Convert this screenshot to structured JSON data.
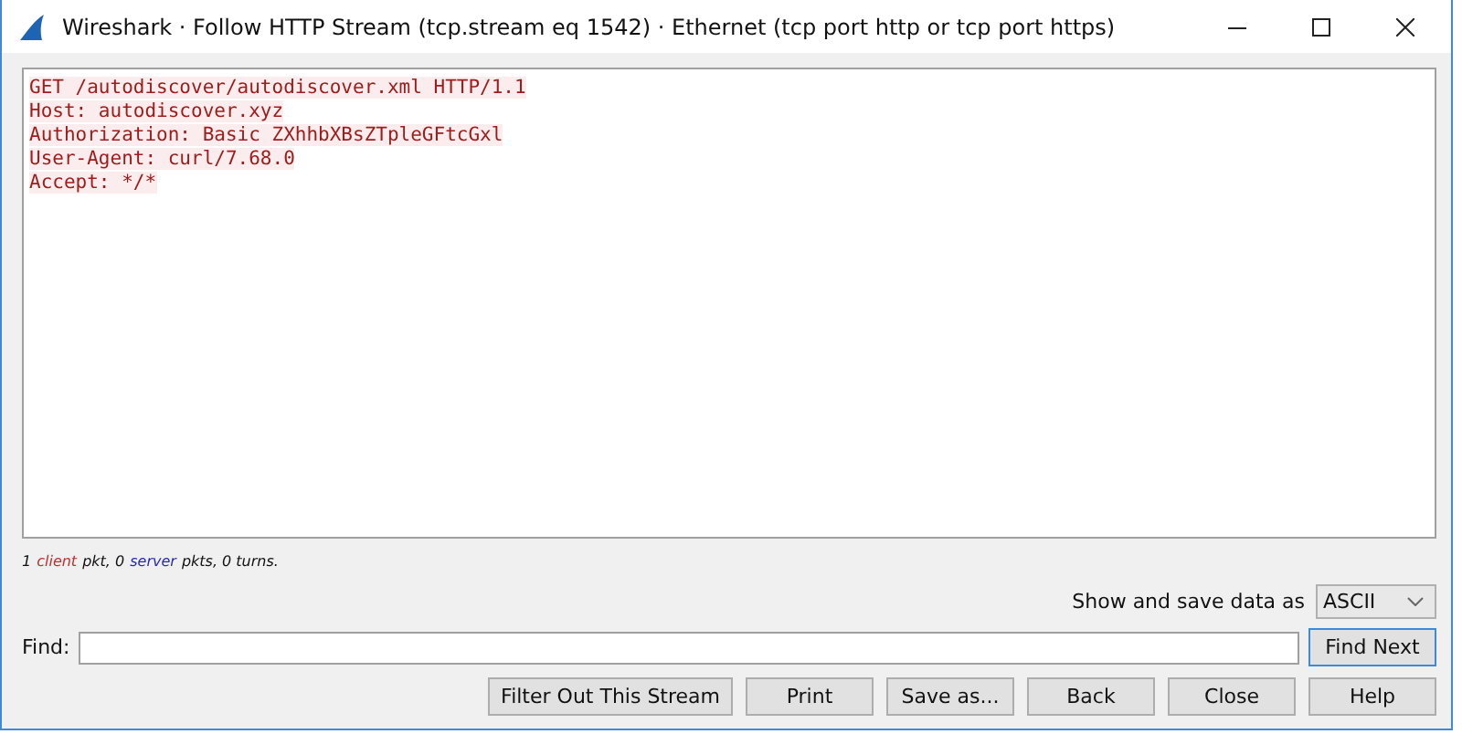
{
  "window": {
    "title": "Wireshark · Follow HTTP Stream (tcp.stream eq 1542) · Ethernet (tcp port http or tcp port https)"
  },
  "stream_lines": [
    {
      "kind": "client",
      "text": "GET /autodiscover/autodiscover.xml HTTP/1.1"
    },
    {
      "kind": "client",
      "text": "Host: autodiscover.xyz"
    },
    {
      "kind": "client",
      "text": "Authorization: Basic ZXhhbXBsZTpleGFtcGxl"
    },
    {
      "kind": "client",
      "text": "User-Agent: curl/7.68.0"
    },
    {
      "kind": "client",
      "text": "Accept: */*"
    }
  ],
  "status": [
    {
      "kind": "plain",
      "text": "1"
    },
    {
      "kind": "client",
      "text": "client"
    },
    {
      "kind": "plain",
      "text": "pkt, 0"
    },
    {
      "kind": "server",
      "text": "server"
    },
    {
      "kind": "plain",
      "text": "pkts, 0 turns."
    }
  ],
  "show_as": {
    "label": "Show and save data as",
    "value": "ASCII"
  },
  "find": {
    "label": "Find:",
    "button": "Find Next"
  },
  "buttons": [
    "Filter Out This Stream",
    "Print",
    "Save as...",
    "Back",
    "Close",
    "Help"
  ]
}
